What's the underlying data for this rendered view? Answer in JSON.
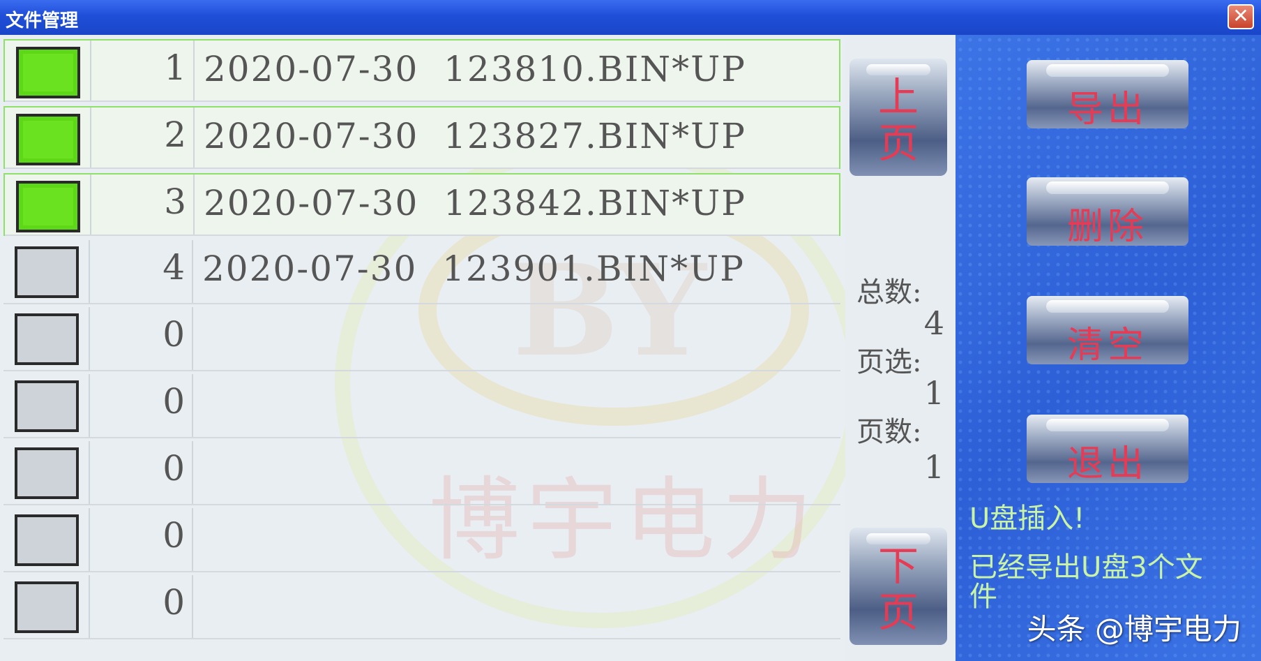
{
  "window": {
    "title": "文件管理",
    "close_label": "✕"
  },
  "files": [
    {
      "index": "1",
      "name": "2020-07-30  123810.BIN*UP",
      "checked": true
    },
    {
      "index": "2",
      "name": "2020-07-30  123827.BIN*UP",
      "checked": true
    },
    {
      "index": "3",
      "name": "2020-07-30  123842.BIN*UP",
      "checked": true
    },
    {
      "index": "4",
      "name": "2020-07-30  123901.BIN*UP",
      "checked": false
    },
    {
      "index": "0",
      "name": "",
      "checked": false
    },
    {
      "index": "0",
      "name": "",
      "checked": false
    },
    {
      "index": "0",
      "name": "",
      "checked": false
    },
    {
      "index": "0",
      "name": "",
      "checked": false
    },
    {
      "index": "0",
      "name": "",
      "checked": false
    }
  ],
  "paging": {
    "prev_line1": "上",
    "prev_line2": "页",
    "next_line1": "下",
    "next_line2": "页",
    "total_label": "总数:",
    "total_value": "4",
    "selected_label": "页选:",
    "selected_value": "1",
    "pages_label": "页数:",
    "pages_value": "1"
  },
  "actions": {
    "export": "导出",
    "delete": "删除",
    "clear": "清空",
    "exit": "退出"
  },
  "status": {
    "usb": "U盘插入!",
    "message": "已经导出U盘3个文件"
  },
  "watermark": {
    "brand": "博宇电力",
    "logo": "BY"
  },
  "credit": "头条 @博宇电力",
  "colors": {
    "accent_text": "#e53b54",
    "check_green": "#5cd817",
    "status_text": "#c9f3a6",
    "title_blue": "#1f4fd8"
  }
}
